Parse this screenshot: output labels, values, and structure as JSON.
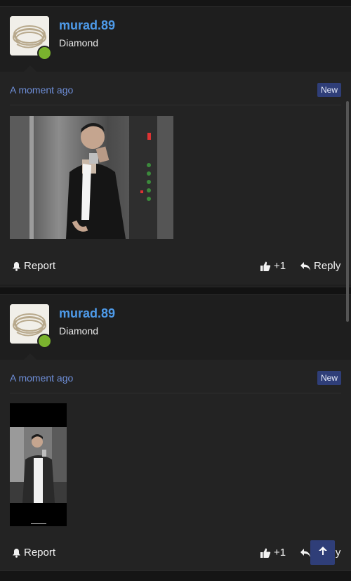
{
  "posts": [
    {
      "username": "murad.89",
      "rank": "Diamond",
      "time": "A moment ago",
      "badge": "New",
      "report_label": "Report",
      "like_label": "+1",
      "reply_label": "Reply"
    },
    {
      "username": "murad.89",
      "rank": "Diamond",
      "time": "A moment ago",
      "badge": "New",
      "report_label": "Report",
      "like_label": "+1",
      "reply_label": "Reply"
    }
  ],
  "icons": {
    "report": "bell-icon",
    "like": "thumbs-up-icon",
    "reply": "reply-icon",
    "scroll_top": "arrow-up-icon"
  },
  "colors": {
    "username": "#4e9bea",
    "time": "#6e8ed8",
    "badge_bg": "#2f3e78",
    "online": "#7ab32e"
  }
}
